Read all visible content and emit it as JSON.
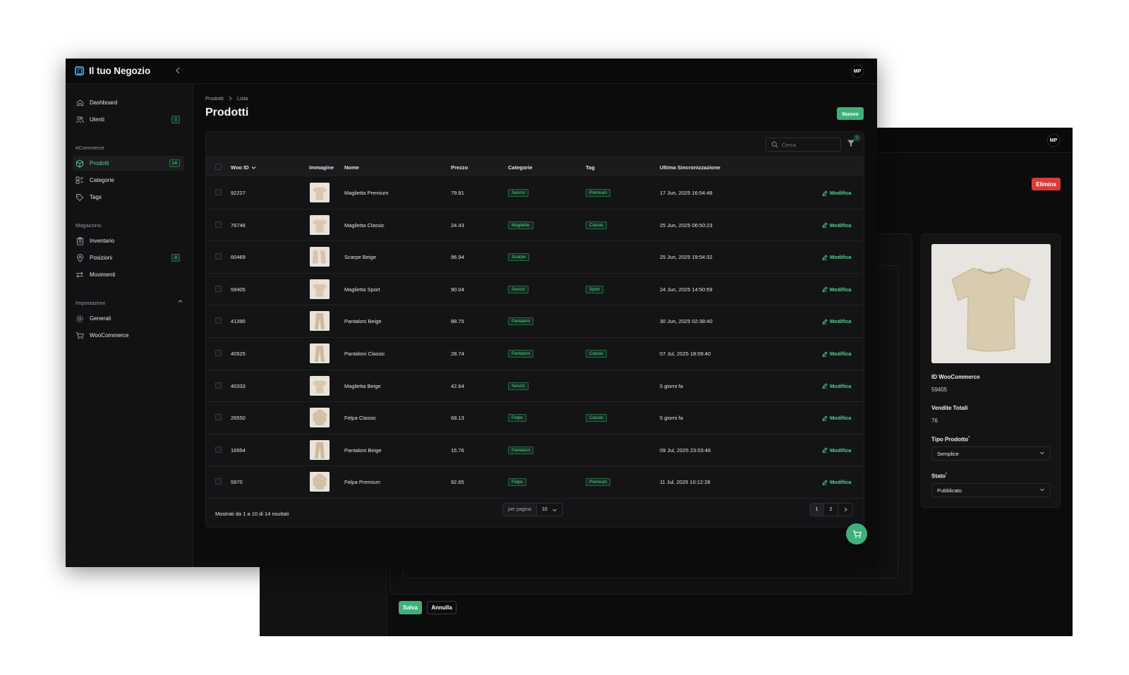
{
  "app": {
    "brand": "Il tuo Negozio",
    "user_initials": "MP"
  },
  "sidebar": {
    "items": [
      {
        "label": "Dashboard",
        "icon": "home-icon"
      },
      {
        "label": "Utenti",
        "icon": "users-icon",
        "badge": "1"
      }
    ],
    "sections": [
      {
        "title": "eCommerce",
        "items": [
          {
            "label": "Prodotti",
            "icon": "box-icon",
            "badge": "14",
            "active": true
          },
          {
            "label": "Categorie",
            "icon": "categories-icon"
          },
          {
            "label": "Tags",
            "icon": "tag-icon"
          }
        ]
      },
      {
        "title": "Magazzino",
        "items": [
          {
            "label": "Inventario",
            "icon": "clipboard-icon"
          },
          {
            "label": "Posizioni",
            "icon": "location-icon",
            "badge": "8"
          },
          {
            "label": "Movimenti",
            "icon": "arrows-icon"
          }
        ]
      },
      {
        "title": "Impostazioni",
        "items": [
          {
            "label": "Generali",
            "icon": "gear-icon"
          },
          {
            "label": "WooCommerce",
            "icon": "cart-icon"
          }
        ]
      }
    ]
  },
  "header": {
    "breadcrumb": [
      "Prodotti",
      "Lista"
    ],
    "title": "Prodotti",
    "new_label": "Nuovo"
  },
  "table": {
    "search_placeholder": "Cerca",
    "filter_count": "0",
    "columns": [
      "Woo ID",
      "Immagine",
      "Nome",
      "Prezzo",
      "Categorie",
      "Tag",
      "Ultima Sincronizzazione"
    ],
    "edit_label": "Modifica",
    "rows": [
      {
        "id": "92227",
        "name": "Maglietta Premium",
        "price": "79.81",
        "category": "Servizi",
        "tag": "Premium",
        "sync": "17 Jun, 2025 16:54:48",
        "thumb": "tshirt"
      },
      {
        "id": "76746",
        "name": "Maglietta Classic",
        "price": "24.43",
        "category": "Magliette",
        "tag": "Classic",
        "sync": "25 Jun, 2025 06:50:23",
        "thumb": "tshirt"
      },
      {
        "id": "60469",
        "name": "Scarpe Beige",
        "price": "96.94",
        "category": "Scarpe",
        "tag": "",
        "sync": "25 Jun, 2025 19:54:32",
        "thumb": "shoes"
      },
      {
        "id": "59405",
        "name": "Maglietta Sport",
        "price": "90.04",
        "category": "Servizi",
        "tag": "Sport",
        "sync": "24 Jun, 2025 14:50:59",
        "thumb": "tshirt"
      },
      {
        "id": "41390",
        "name": "Pantaloni Beige",
        "price": "88.75",
        "category": "Pantaloni",
        "tag": "",
        "sync": "30 Jun, 2025 02:38:40",
        "thumb": "pants"
      },
      {
        "id": "40525",
        "name": "Pantaloni Classic",
        "price": "28.74",
        "category": "Pantaloni",
        "tag": "Classic",
        "sync": "07 Jul, 2025 18:09:40",
        "thumb": "pants"
      },
      {
        "id": "40333",
        "name": "Maglietta Beige",
        "price": "42.64",
        "category": "Servizi",
        "tag": "",
        "sync": "5 giorni fa",
        "thumb": "tshirt"
      },
      {
        "id": "26550",
        "name": "Felpa Classic",
        "price": "68.13",
        "category": "Felpe",
        "tag": "Classic",
        "sync": "5 giorni fa",
        "thumb": "hoodie"
      },
      {
        "id": "16954",
        "name": "Pantaloni Beige",
        "price": "15.76",
        "category": "Pantaloni",
        "tag": "",
        "sync": "09 Jul, 2025 23:03:46",
        "thumb": "pants"
      },
      {
        "id": "5970",
        "name": "Felpa Premium",
        "price": "92.65",
        "category": "Felpe",
        "tag": "Premium",
        "sync": "11 Jul, 2025 10:12:28",
        "thumb": "hoodie"
      }
    ],
    "footer_text": "Mostrati da 1 a 10 di 14 risultati",
    "per_page_label": "per pagina",
    "per_page_value": "10",
    "pages": [
      "1",
      "2"
    ]
  },
  "edit_panel": {
    "delete_label": "Elimina",
    "fields": [
      {
        "label": "ID WooCommerce",
        "value": "59405"
      },
      {
        "label": "Vendite Totali",
        "value": "76"
      }
    ],
    "type_label": "Tipo Prodotto",
    "type_value": "Semplice",
    "status_label": "Stato",
    "status_value": "Pubblicato",
    "required_mark": "*",
    "save_label": "Salva",
    "cancel_label": "Annulla"
  },
  "colors": {
    "accent": "#3fb07a",
    "danger": "#dc3a3a",
    "background": "#0c0c0d",
    "link": "#4fd394"
  }
}
